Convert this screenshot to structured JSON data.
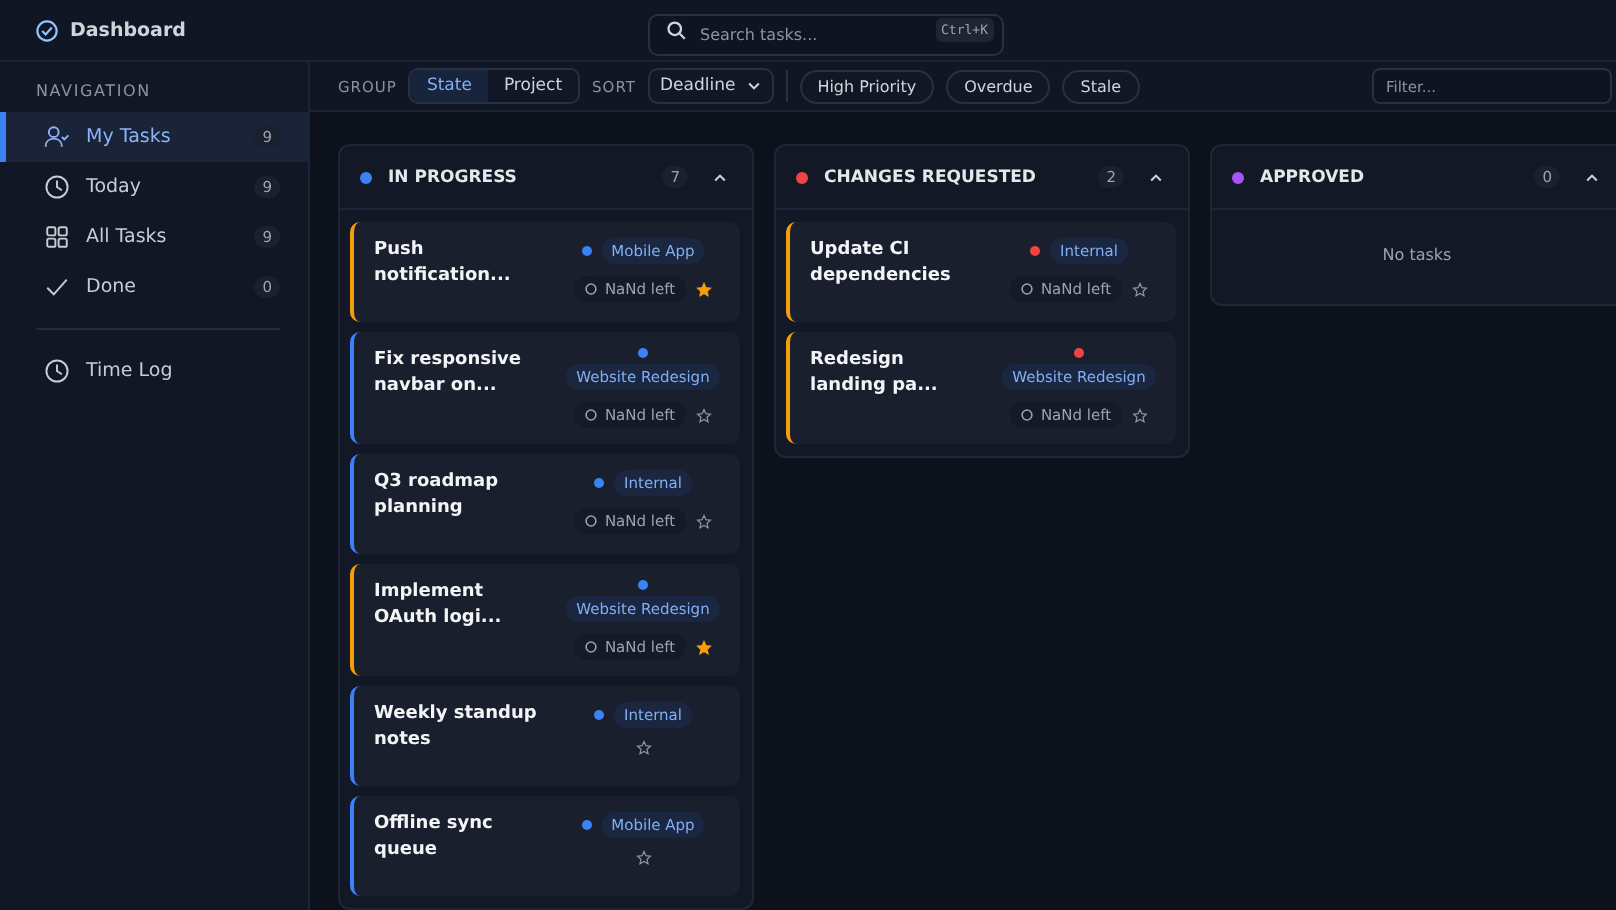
{
  "app_bar": {
    "title": "Dashboard",
    "search": {
      "placeholder": "Search tasks...",
      "shortcut": "Ctrl+K"
    }
  },
  "sidebar": {
    "heading": "NAVIGATION",
    "items": [
      {
        "label": "My Tasks",
        "count": "9",
        "selected": true
      },
      {
        "label": "Today",
        "count": "9",
        "selected": false
      },
      {
        "label": "All Tasks",
        "count": "9",
        "selected": false
      },
      {
        "label": "Done",
        "count": "0",
        "selected": false
      }
    ],
    "secondary_items": [
      {
        "label": "Time Log",
        "selected": false
      }
    ]
  },
  "toolbar": {
    "group_label": "GROUP",
    "group_options": [
      {
        "label": "State",
        "selected": true
      },
      {
        "label": "Project",
        "selected": false
      }
    ],
    "sort_label": "SORT",
    "sort_value": "Deadline",
    "filters": [
      {
        "label": "High Priority",
        "selected": false
      },
      {
        "label": "Overdue",
        "selected": false
      },
      {
        "label": "Stale",
        "selected": false
      }
    ],
    "filter_placeholder": "Filter..."
  },
  "columns": [
    {
      "title": "IN PROGRESS",
      "color": "#3b82f6",
      "count": "7",
      "cards": [
        {
          "title": "Push notification...",
          "project": "Mobile App",
          "time_left": "NaNd left",
          "starred": true,
          "color": "#f59e0b"
        },
        {
          "title": "Fix responsive navbar on...",
          "project": "Website Redesign",
          "time_left": "NaNd left",
          "starred": false,
          "color": "#3b82f6"
        },
        {
          "title": "Q3 roadmap planning",
          "project": "Internal",
          "time_left": "NaNd left",
          "starred": false,
          "color": "#3b82f6"
        },
        {
          "title": "Implement OAuth logi...",
          "project": "Website Redesign",
          "time_left": "NaNd left",
          "starred": true,
          "color": "#f59e0b"
        },
        {
          "title": "Weekly standup notes",
          "project": "Internal",
          "starred": false,
          "color": "#3b82f6"
        },
        {
          "title": "Offline sync queue",
          "project": "Mobile App",
          "starred": false,
          "color": "#3b82f6"
        }
      ]
    },
    {
      "title": "CHANGES REQUESTED",
      "color": "#ef4444",
      "count": "2",
      "cards": [
        {
          "title": "Update CI dependencies",
          "project": "Internal",
          "time_left": "NaNd left",
          "starred": false,
          "color": "#f59e0b"
        },
        {
          "title": "Redesign landing pa...",
          "project": "Website Redesign",
          "time_left": "NaNd left",
          "starred": false,
          "color": "#f59e0b"
        }
      ]
    },
    {
      "title": "APPROVED",
      "color": "#a855f7",
      "count": "0",
      "empty_text": "No tasks"
    }
  ]
}
